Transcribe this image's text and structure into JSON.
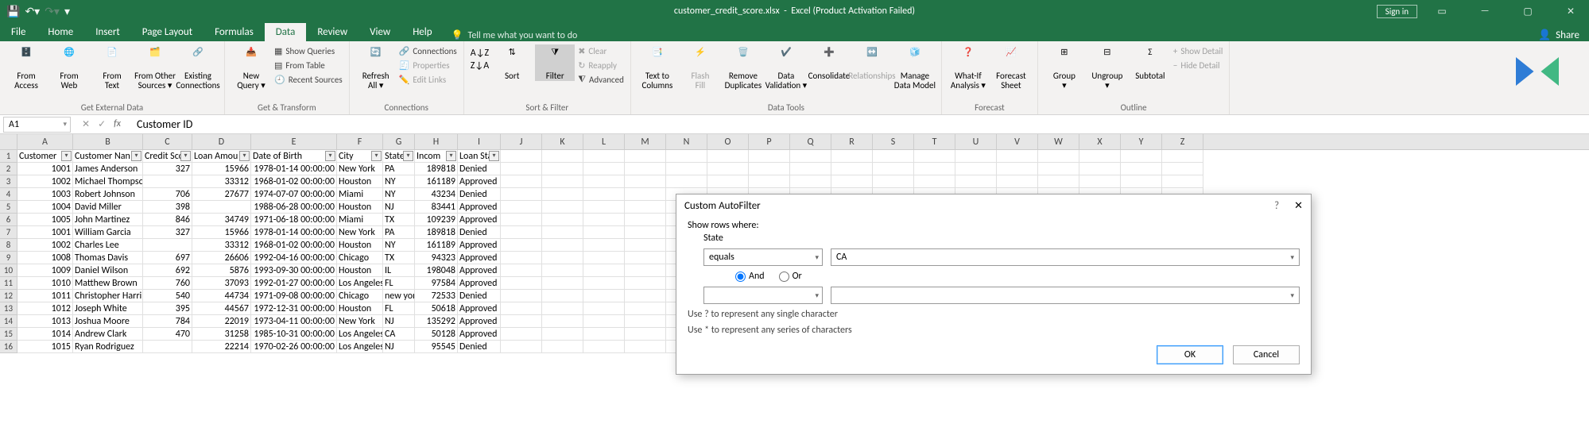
{
  "titlebar": {
    "filename": "customer_credit_score.xlsx",
    "app": "Excel (Product Activation Failed)",
    "signin": "Sign in"
  },
  "tabs": [
    "File",
    "Home",
    "Insert",
    "Page Layout",
    "Formulas",
    "Data",
    "Review",
    "View",
    "Help"
  ],
  "tellme": "Tell me what you want to do",
  "share": "Share",
  "ribbon": {
    "get_external": {
      "from_access": "From\nAccess",
      "from_web": "From\nWeb",
      "from_text": "From\nText",
      "from_other": "From Other\nSources ▾",
      "existing": "Existing\nConnections",
      "label": "Get External Data"
    },
    "get_transform": {
      "new_query": "New\nQuery ▾",
      "show_queries": "Show Queries",
      "from_table": "From Table",
      "recent": "Recent Sources",
      "label": "Get & Transform"
    },
    "connections": {
      "refresh": "Refresh\nAll ▾",
      "connections": "Connections",
      "properties": "Properties",
      "edit_links": "Edit Links",
      "label": "Connections"
    },
    "sort_filter": {
      "sort": "Sort",
      "filter": "Filter",
      "clear": "Clear",
      "reapply": "Reapply",
      "advanced": "Advanced",
      "label": "Sort & Filter"
    },
    "data_tools": {
      "ttc": "Text to\nColumns",
      "flash": "Flash\nFill",
      "removedup": "Remove\nDuplicates",
      "dataval": "Data\nValidation ▾",
      "consolidate": "Consolidate",
      "relationships": "Relationships",
      "manage": "Manage\nData Model",
      "label": "Data Tools"
    },
    "forecast": {
      "whatif": "What-If\nAnalysis ▾",
      "sheet": "Forecast\nSheet",
      "label": "Forecast"
    },
    "outline": {
      "group": "Group\n▾",
      "ungroup": "Ungroup\n▾",
      "subtotal": "Subtotal",
      "show_detail": "Show Detail",
      "hide_detail": "Hide Detail",
      "label": "Outline"
    }
  },
  "namebox": "A1",
  "formula": "Customer ID",
  "col_letters": [
    "A",
    "B",
    "C",
    "D",
    "E",
    "F",
    "G",
    "H",
    "I",
    "J",
    "K",
    "L",
    "M",
    "N",
    "O",
    "P",
    "Q",
    "R",
    "S",
    "T",
    "U",
    "V",
    "W",
    "X",
    "Y",
    "Z"
  ],
  "headers": [
    "Customer",
    "Customer Nan",
    "Credit Sco",
    "Loan Amou",
    "Date of Birth",
    "City",
    "State",
    "Incom",
    "Loan Stat"
  ],
  "rows": [
    {
      "n": 1,
      "id": "1001",
      "name": "James Anderson",
      "score": "327",
      "loan": "15966",
      "dob": "1978-01-14 00:00:00",
      "city": "New York",
      "state": "PA",
      "income": "189818",
      "status": "Denied"
    },
    {
      "n": 2,
      "id": "1002",
      "name": "Michael Thompson",
      "score": "",
      "loan": "33312",
      "dob": "1968-01-02 00:00:00",
      "city": "Houston",
      "state": "NY",
      "income": "161189",
      "status": "Approved"
    },
    {
      "n": 3,
      "id": "1003",
      "name": "Robert Johnson",
      "score": "706",
      "loan": "27677",
      "dob": "1974-07-07 00:00:00",
      "city": "Miami",
      "state": "NY",
      "income": "43234",
      "status": "Denied"
    },
    {
      "n": 4,
      "id": "1004",
      "name": "David Miller",
      "score": "398",
      "loan": "",
      "dob": "1988-06-28 00:00:00",
      "city": "Houston",
      "state": "NJ",
      "income": "83441",
      "status": "Approved"
    },
    {
      "n": 5,
      "id": "1005",
      "name": "John Martinez",
      "score": "846",
      "loan": "34749",
      "dob": "1971-06-18 00:00:00",
      "city": "Miami",
      "state": "TX",
      "income": "109239",
      "status": "Approved"
    },
    {
      "n": 6,
      "id": "1001",
      "name": "William Garcia",
      "score": "327",
      "loan": "15966",
      "dob": "1978-01-14 00:00:00",
      "city": "New York",
      "state": "PA",
      "income": "189818",
      "status": "Denied"
    },
    {
      "n": 7,
      "id": "1002",
      "name": "Charles Lee",
      "score": "",
      "loan": "33312",
      "dob": "1968-01-02 00:00:00",
      "city": "Houston",
      "state": "NY",
      "income": "161189",
      "status": "Approved"
    },
    {
      "n": 8,
      "id": "1008",
      "name": "Thomas Davis",
      "score": "697",
      "loan": "26606",
      "dob": "1992-04-16 00:00:00",
      "city": "Chicago",
      "state": "TX",
      "income": "94323",
      "status": "Approved"
    },
    {
      "n": 9,
      "id": "1009",
      "name": "Daniel Wilson",
      "score": "692",
      "loan": "5876",
      "dob": "1993-09-30 00:00:00",
      "city": "Houston",
      "state": "IL",
      "income": "198048",
      "status": "Approved"
    },
    {
      "n": 10,
      "id": "1010",
      "name": "Matthew Brown",
      "score": "760",
      "loan": "37093",
      "dob": "1992-01-27 00:00:00",
      "city": "Los Angeles",
      "state": "FL",
      "income": "97584",
      "status": "Approved"
    },
    {
      "n": 11,
      "id": "1011",
      "name": "Christopher Harri",
      "score": "540",
      "loan": "44734",
      "dob": "1971-09-08 00:00:00",
      "city": "Chicago",
      "state": "new york",
      "income": "72533",
      "status": "Denied"
    },
    {
      "n": 12,
      "id": "1012",
      "name": "Joseph White",
      "score": "395",
      "loan": "44567",
      "dob": "1972-12-31 00:00:00",
      "city": "Houston",
      "state": "FL",
      "income": "50618",
      "status": "Approved"
    },
    {
      "n": 13,
      "id": "1013",
      "name": "Joshua Moore",
      "score": "784",
      "loan": "22019",
      "dob": "1973-04-11 00:00:00",
      "city": "New York",
      "state": "NJ",
      "income": "135292",
      "status": "Approved"
    },
    {
      "n": 14,
      "id": "1014",
      "name": "Andrew Clark",
      "score": "470",
      "loan": "31258",
      "dob": "1985-10-31 00:00:00",
      "city": "Los Angeles",
      "state": "CA",
      "income": "50128",
      "status": "Approved"
    },
    {
      "n": 15,
      "id": "1015",
      "name": "Ryan Rodriguez",
      "score": "",
      "loan": "22214",
      "dob": "1970-02-26 00:00:00",
      "city": "Los Angeles",
      "state": "NJ",
      "income": "95545",
      "status": "Denied"
    }
  ],
  "dialog": {
    "title": "Custom AutoFilter",
    "help": "?",
    "close": "✕",
    "show_rows": "Show rows where:",
    "field": "State",
    "op1": "equals",
    "val1": "CA",
    "and": "And",
    "or": "Or",
    "op2": "",
    "val2": "",
    "hint1": "Use ? to represent any single character",
    "hint2": "Use * to represent any series of characters",
    "ok": "OK",
    "cancel": "Cancel"
  }
}
